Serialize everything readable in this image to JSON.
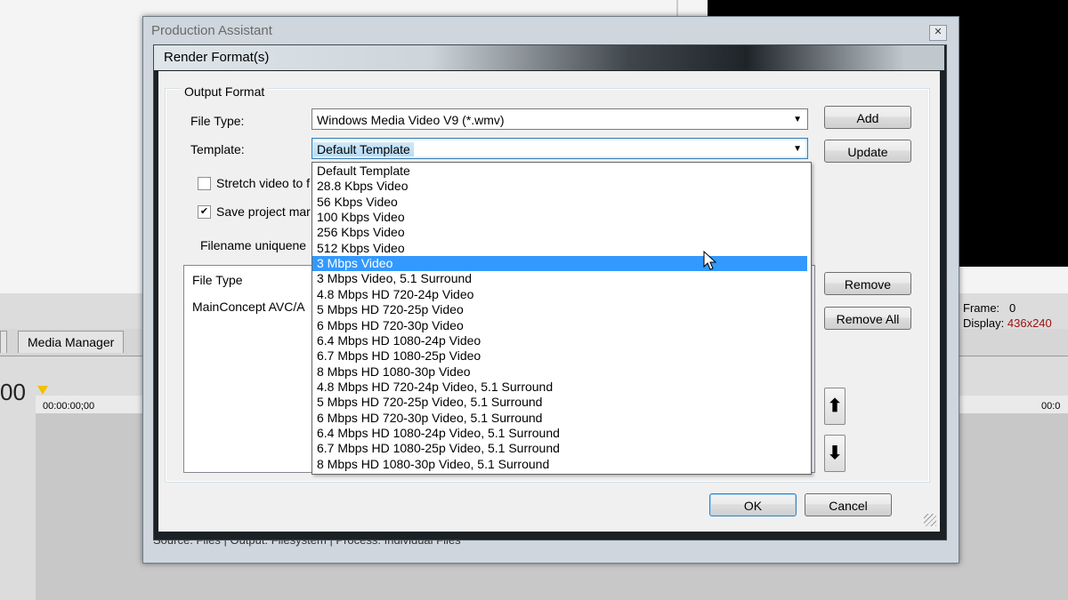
{
  "background_app": {
    "tabs": [
      "Media Manager"
    ],
    "time_display": "00",
    "ruler_left": "00:00:00;00",
    "ruler_right": "00:0",
    "frame_label": "Frame:",
    "frame_value": "0",
    "display_label": "Display:",
    "display_value": "436x240",
    "status_bar": "Source: Files  |  Output: Filesystem  |  Process: Individual Files"
  },
  "outer_dialog": {
    "title": "Production Assistant",
    "close_glyph": "✕"
  },
  "render_dialog": {
    "title": "Render Format(s)",
    "group_label": "Output Format",
    "file_type_label": "File Type:",
    "file_type_value": "Windows Media Video V9 (*.wmv)",
    "template_label": "Template:",
    "template_value": "Default Template",
    "stretch_label": "Stretch video to f",
    "stretch_checked": false,
    "save_markers_label": "Save project mar",
    "save_markers_checked": true,
    "filename_label": "Filename uniquene",
    "list": {
      "header": "File Type",
      "rows": [
        "MainConcept AVC/A"
      ]
    },
    "buttons": {
      "add": "Add",
      "update": "Update",
      "remove": "Remove",
      "remove_all": "Remove All",
      "ok": "OK",
      "cancel": "Cancel",
      "move_up": "⬆",
      "move_down": "⬇"
    },
    "dropdown_selected_index": 6,
    "template_options": [
      "Default Template",
      "28.8 Kbps Video",
      "56 Kbps Video",
      "100 Kbps Video",
      "256 Kbps Video",
      "512 Kbps Video",
      "3 Mbps Video",
      "3 Mbps Video, 5.1 Surround",
      "4.8 Mbps HD 720-24p Video",
      "5 Mbps HD 720-25p Video",
      "6 Mbps HD 720-30p Video",
      "6.4 Mbps HD 1080-24p Video",
      "6.7 Mbps HD 1080-25p Video",
      "8 Mbps HD 1080-30p Video",
      "4.8 Mbps HD 720-24p Video, 5.1 Surround",
      "5 Mbps HD 720-25p Video, 5.1 Surround",
      "6 Mbps HD 720-30p Video, 5.1 Surround",
      "6.4 Mbps HD 1080-24p Video, 5.1 Surround",
      "6.7 Mbps HD 1080-25p Video, 5.1 Surround",
      "8 Mbps HD 1080-30p Video, 5.1 Surround"
    ]
  },
  "colors": {
    "selection": "#3399ff",
    "dialog_frame": "#1b2124"
  }
}
